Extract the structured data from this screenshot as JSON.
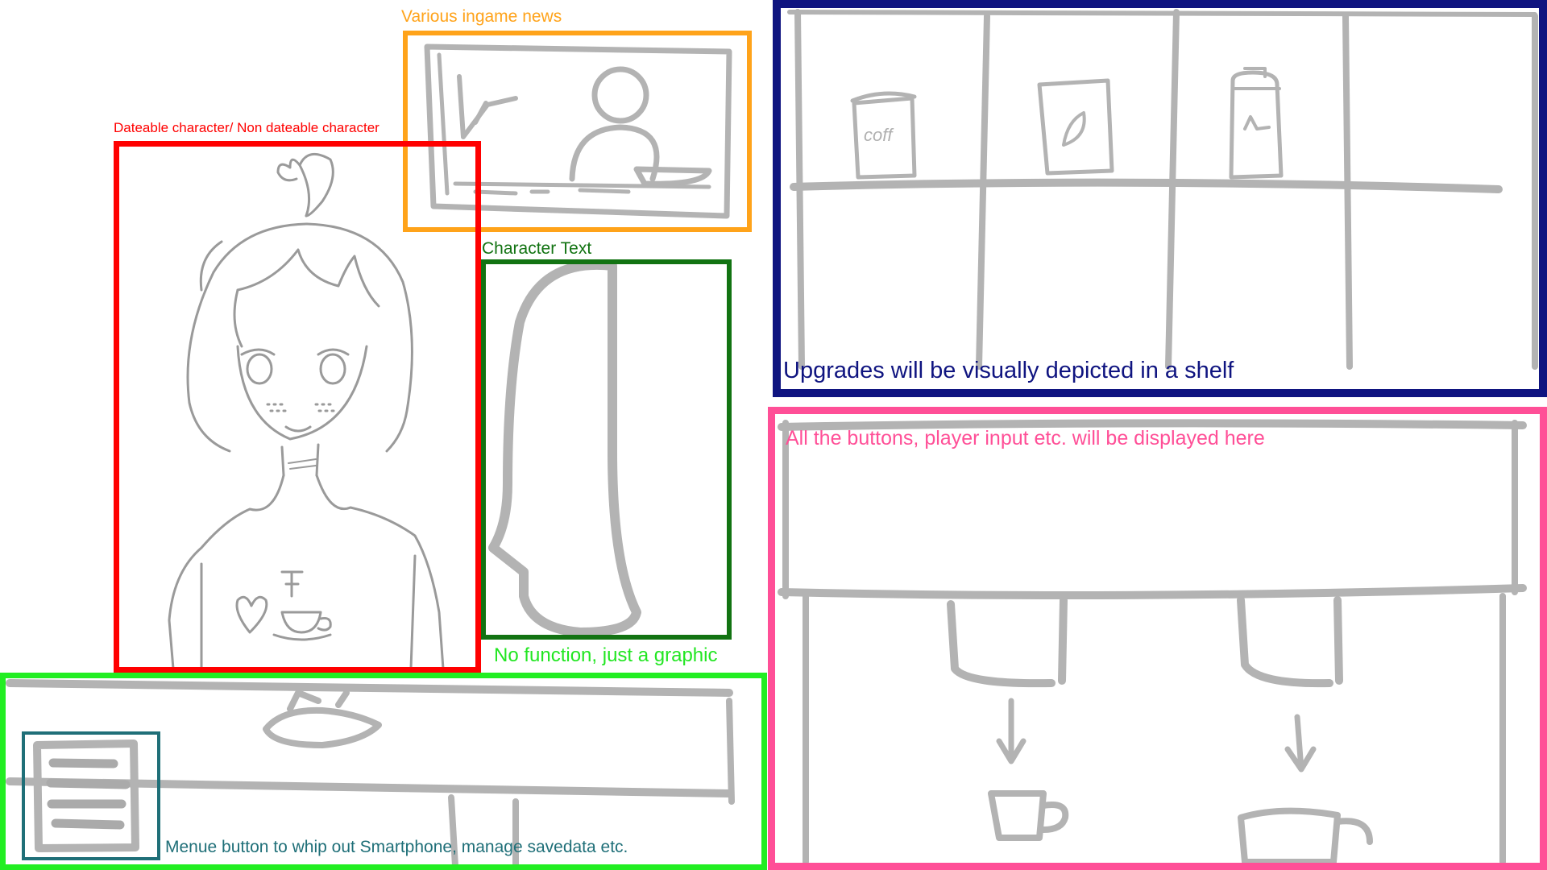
{
  "labels": {
    "news": "Various ingame news",
    "character": "Dateable character/ Non dateable character",
    "character_text": "Character Text",
    "no_function": "No function, just a graphic",
    "menu": "Menue button to whip out Smartphone, manage savedata etc.",
    "shelf": "Upgrades will be visually depicted in a shelf",
    "buttons": "All the buttons, player input etc. will be displayed here",
    "coffee_can": "coff"
  },
  "colors": {
    "news": "#ffa31a",
    "character": "#ff0000",
    "character_text": "#127312",
    "no_function": "#22e622",
    "menu_outer": "#22ee22",
    "menu_button": "#1f6f78",
    "shelf": "#0f1480",
    "buttons": "#ff4f97"
  }
}
